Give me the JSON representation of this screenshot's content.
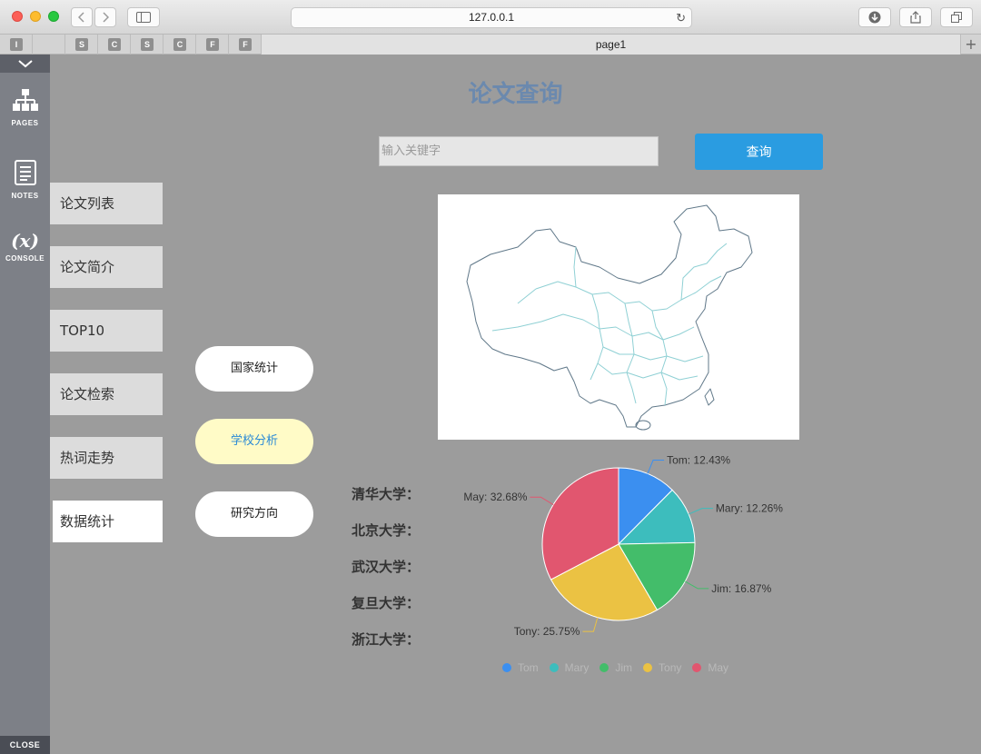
{
  "browser": {
    "url": "127.0.0.1",
    "tabs_mini": [
      "I",
      "",
      "S",
      "C",
      "S",
      "C",
      "F",
      "F"
    ],
    "active_tab": "page1"
  },
  "toolstrip": {
    "pages": "PAGES",
    "notes": "NOTES",
    "console_symbol": "(x)",
    "console": "CONSOLE",
    "close": "CLOSE"
  },
  "page": {
    "title": "论文查询",
    "search": {
      "placeholder": "输入关键字",
      "value": ""
    },
    "query_button": "查询"
  },
  "nav": [
    {
      "label": "论文列表",
      "active": false
    },
    {
      "label": "论文简介",
      "active": false
    },
    {
      "label": "TOP10",
      "active": false
    },
    {
      "label": "论文检索",
      "active": false
    },
    {
      "label": "热词走势",
      "active": false
    },
    {
      "label": "数据统计",
      "active": true
    }
  ],
  "subnav": [
    {
      "label": "国家统计",
      "active": false
    },
    {
      "label": "学校分析",
      "active": true
    },
    {
      "label": "研究方向",
      "active": false
    }
  ],
  "universities": [
    "清华大学：",
    "北京大学：",
    "武汉大学：",
    "复旦大学：",
    "浙江大学："
  ],
  "chart_data": {
    "type": "pie",
    "title": "",
    "categories": [
      "Tom",
      "Mary",
      "Jim",
      "Tony",
      "May"
    ],
    "values": [
      12.43,
      12.26,
      16.87,
      25.75,
      32.68
    ],
    "labels": [
      "Tom: 12.43%",
      "Mary: 12.26%",
      "Jim: 16.87%",
      "Tony: 25.75%",
      "May: 32.68%"
    ],
    "colors": [
      "#3b8ff0",
      "#3dbdbd",
      "#43bd6a",
      "#ebc243",
      "#e1566f"
    ],
    "legend_position": "bottom"
  }
}
